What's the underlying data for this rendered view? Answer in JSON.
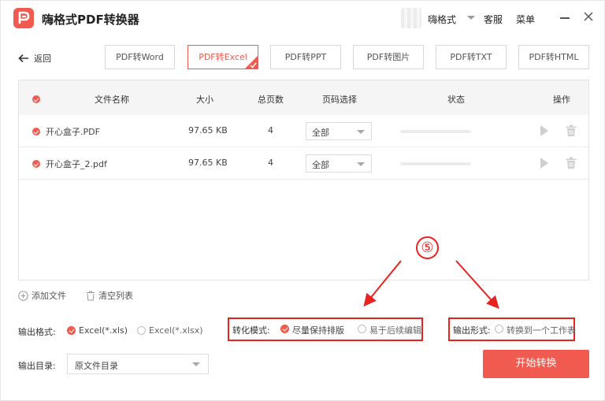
{
  "app": {
    "title": "嗨格式PDF转换器",
    "user_name": "嗨格式",
    "service_label": "客服",
    "menu_label": "菜单"
  },
  "nav": {
    "back_label": "返回"
  },
  "tabs": [
    {
      "label": "PDF转Word",
      "active": false
    },
    {
      "label": "PDF转Excel",
      "active": true
    },
    {
      "label": "PDF转PPT",
      "active": false
    },
    {
      "label": "PDF转图片",
      "active": false
    },
    {
      "label": "PDF转TXT",
      "active": false
    },
    {
      "label": "PDF转HTML",
      "active": false
    }
  ],
  "table": {
    "headers": {
      "name": "文件名称",
      "size": "大小",
      "pages": "总页数",
      "page_select": "页码选择",
      "status": "状态",
      "actions": "操作"
    },
    "rows": [
      {
        "name": "开心盒子.PDF",
        "size": "97.65 KB",
        "pages": "4",
        "page_select": "全部",
        "progress": 0
      },
      {
        "name": "开心盒子_2.pdf",
        "size": "97.65 KB",
        "pages": "4",
        "page_select": "全部",
        "progress": 0
      }
    ]
  },
  "file_actions": {
    "add_label": "添加文件",
    "clear_label": "清空列表"
  },
  "options": {
    "format_label": "输出格式:",
    "format_options": [
      {
        "label": "Excel(*.xls)",
        "selected": true
      },
      {
        "label": "Excel(*.xlsx)",
        "selected": false
      }
    ],
    "mode_label": "转化模式:",
    "mode_options": [
      {
        "label": "尽量保持排版",
        "selected": true
      },
      {
        "label": "易于后续编辑",
        "selected": false
      }
    ],
    "output_form_label": "输出形式:",
    "output_form_option": {
      "label": "转换到一个工作表",
      "selected": false
    },
    "dir_label": "输出目录:",
    "dir_value": "原文件目录"
  },
  "start_button_label": "开始转换",
  "annotation": {
    "marker": "⑤"
  },
  "colors": {
    "accent": "#f15a4f",
    "annotation": "#e8231f"
  }
}
